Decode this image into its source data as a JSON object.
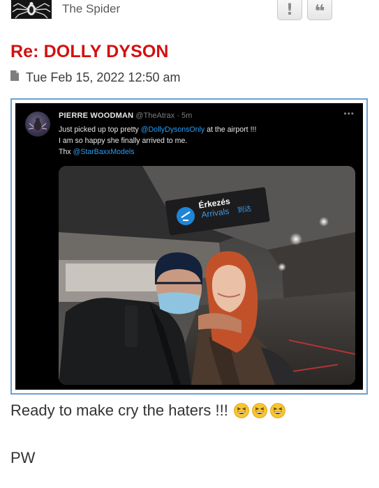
{
  "post": {
    "author": "The Spider",
    "title": "Re: DOLLY DYSON",
    "date": "Tue Feb 15, 2022 12:50 am",
    "body_text": "Ready to make cry the haters !!!",
    "signature": "PW"
  },
  "actions": {
    "report_glyph": "!",
    "quote_glyph": "❝"
  },
  "icons": {
    "author_avatar": "spider-avatar-icon",
    "date": "file-icon",
    "report": "report-icon",
    "quote": "quote-icon",
    "emoji": "grinning-squinting-face-icon"
  },
  "emoji_count": 3,
  "tweet": {
    "name": "PIERRE WOODMAN",
    "handle": "@TheAtrax",
    "separator": "·",
    "time": "5m",
    "more": "•••",
    "line1_a": "Just picked up top pretty ",
    "line1_mention": "@DollyDysonsOnly",
    "line1_b": " at the airport !!!",
    "line2": "I am so happy she finally arrived to me.",
    "line3_a": "Thx ",
    "line3_mention": "@StarBaxxModels"
  },
  "photo_sign": {
    "line1": "Érkezés",
    "line2": "Arrivals",
    "line3": "到达"
  },
  "colors": {
    "title": "#d31010",
    "frame_border": "#6aa0d2",
    "mention": "#2a9df4",
    "sign_blue": "#1f86d6"
  }
}
